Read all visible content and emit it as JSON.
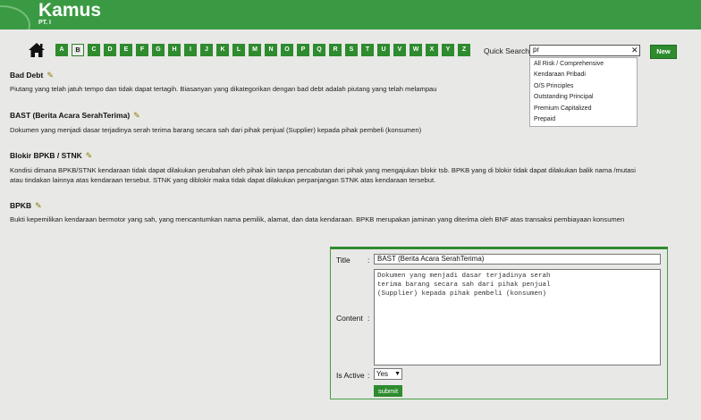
{
  "header": {
    "title": "Kamus",
    "subtitle": "PT. I"
  },
  "nav": {
    "letters": [
      "A",
      "B",
      "C",
      "D",
      "E",
      "F",
      "G",
      "H",
      "I",
      "J",
      "K",
      "L",
      "M",
      "N",
      "O",
      "P",
      "Q",
      "R",
      "S",
      "T",
      "U",
      "V",
      "W",
      "X",
      "Y",
      "Z"
    ],
    "active_letter": "B",
    "home_icon": "home-icon"
  },
  "search": {
    "label": "Quick Search",
    "value": "pr",
    "clear_glyph": "✕",
    "suggestions": [
      "All Risk / Comprehensive",
      "Kendaraan Pribadi",
      "O/S Principles",
      "Outstanding Principal",
      "Premium Capitalized",
      "Prepaid"
    ]
  },
  "new_button": "New",
  "entries": [
    {
      "title": "Bad Debt",
      "desc": "Piutang yang telah jatuh tempo dan tidak dapat tertagih. Biasanyan yang dikategorikan dengan bad debt adalah piutang yang telah melampau"
    },
    {
      "title": "BAST (Berita Acara SerahTerima)",
      "desc": "Dokumen yang menjadi dasar terjadinya serah terima barang secara sah dari pihak penjual (Supplier) kepada pihak pembeli (konsumen)"
    },
    {
      "title": "Blokir BPKB / STNK",
      "desc": "Kondisi dimana BPKB/STNK kendaraan tidak dapat dilakukan perubahan oleh pihak lain tanpa pencabutan dari pihak yang mengajukan blokir tsb. BPKB yang di blokir tidak dapat dilakukan balik nama /mutasi",
      "desc2": "atau tindakan lainnya atas kendaraan tersebut. STNK yang diblokir maka tidak dapat dilakukan perpanjangan STNK atas kendaraan tersebut."
    },
    {
      "title": "BPKB",
      "desc": "Bukti kepemilikan kendaraan bermotor yang sah, yang mencantumkan nama pemilik, alamat, dan data kendaraan. BPKB merupakan jaminan yang diterima oleh BNF atas transaksi pembiayaan konsumen"
    }
  ],
  "form": {
    "title_label": "Title",
    "content_label": "Content",
    "active_label": "Is Active",
    "colon": ":",
    "title_value": "BAST (Berita Acara SerahTerima)",
    "content_value": "Dokumen yang menjadi dasar terjadinya serah\nterima barang secara sah dari pihak penjual\n(Supplier) kepada pihak pembeli (konsumen)",
    "active_value": "Yes",
    "submit_label": "submit"
  },
  "colors": {
    "header": "#3a9a43",
    "button": "#2e8b2e",
    "pencil": "#8a7d00"
  }
}
